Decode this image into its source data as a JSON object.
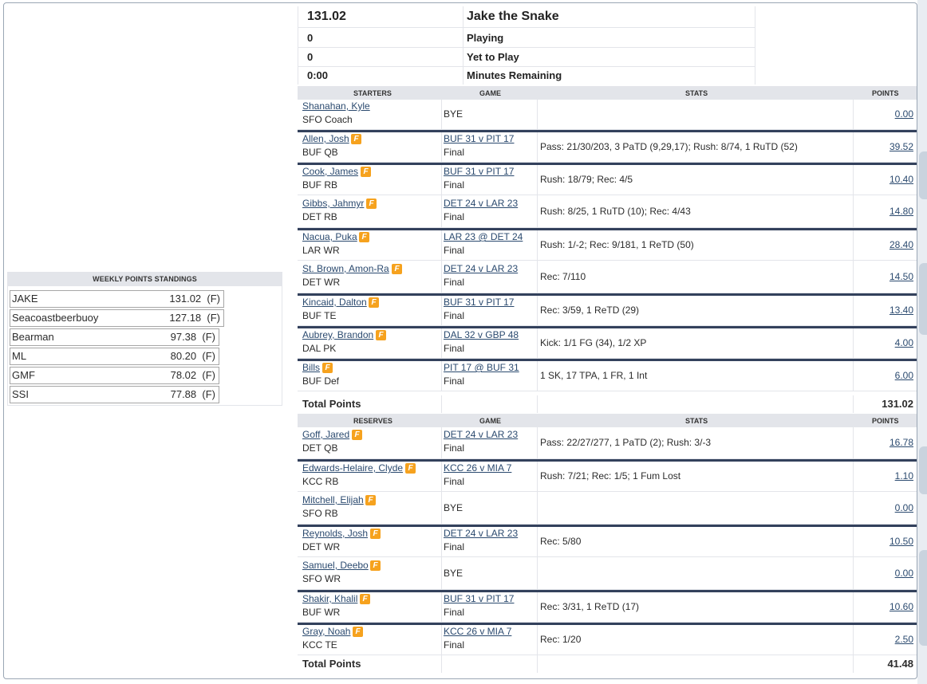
{
  "standings": {
    "title": "WEEKLY POINTS STANDINGS",
    "rows": [
      {
        "name": "JAKE",
        "points": "131.02",
        "flag": "(F)"
      },
      {
        "name": "Seacoastbeerbuoy",
        "points": "127.18",
        "flag": "(F)"
      },
      {
        "name": "Bearman",
        "points": "97.38",
        "flag": "(F)"
      },
      {
        "name": "ML",
        "points": "80.20",
        "flag": "(F)"
      },
      {
        "name": "GMF",
        "points": "78.02",
        "flag": "(F)"
      },
      {
        "name": "SSI",
        "points": "77.88",
        "flag": "(F)"
      }
    ]
  },
  "header": {
    "score": "131.02",
    "team": "Jake the Snake",
    "playing": {
      "value": "0",
      "label": "Playing"
    },
    "yet": {
      "value": "0",
      "label": "Yet to Play"
    },
    "minutes": {
      "value": "0:00",
      "label": "Minutes Remaining"
    }
  },
  "starters": {
    "columns": {
      "a": "STARTERS",
      "b": "GAME",
      "c": "STATS",
      "d": "POINTS"
    },
    "rows": [
      {
        "name": "Shanahan, Kyle",
        "pos": "SFO Coach",
        "game": "",
        "status": "BYE",
        "stats": "",
        "points": "0.00",
        "icon": false
      },
      {
        "name": "Allen, Josh",
        "pos": "BUF QB",
        "game": "BUF 31 v PIT 17",
        "status": "Final",
        "stats": "Pass: 21/30/203, 3 PaTD (9,29,17); Rush: 8/74, 1 RuTD (52)",
        "points": "39.52",
        "icon": true
      },
      {
        "name": "Cook, James",
        "pos": "BUF RB",
        "game": "BUF 31 v PIT 17",
        "status": "Final",
        "stats": "Rush: 18/79; Rec: 4/5",
        "points": "10.40",
        "icon": true
      },
      {
        "name": "Gibbs, Jahmyr",
        "pos": "DET RB",
        "game": "DET 24 v LAR 23",
        "status": "Final",
        "stats": "Rush: 8/25, 1 RuTD (10); Rec: 4/43",
        "points": "14.80",
        "icon": true
      },
      {
        "name": "Nacua, Puka",
        "pos": "LAR WR",
        "game": "LAR 23 @ DET 24",
        "status": "Final",
        "stats": "Rush: 1/-2; Rec: 9/181, 1 ReTD (50)",
        "points": "28.40",
        "icon": true
      },
      {
        "name": "St. Brown, Amon-Ra",
        "pos": "DET WR",
        "game": "DET 24 v LAR 23",
        "status": "Final",
        "stats": "Rec: 7/110",
        "points": "14.50",
        "icon": true
      },
      {
        "name": "Kincaid, Dalton",
        "pos": "BUF TE",
        "game": "BUF 31 v PIT 17",
        "status": "Final",
        "stats": "Rec: 3/59, 1 ReTD (29)",
        "points": "13.40",
        "icon": true
      },
      {
        "name": "Aubrey, Brandon",
        "pos": "DAL PK",
        "game": "DAL 32 v GBP 48",
        "status": "Final",
        "stats": "Kick: 1/1 FG (34), 1/2 XP",
        "points": "4.00",
        "icon": true
      },
      {
        "name": "Bills",
        "pos": "BUF Def",
        "game": "PIT 17 @ BUF 31",
        "status": "Final",
        "stats": "1 SK, 17 TPA, 1 FR, 1 Int",
        "points": "6.00",
        "icon": true
      }
    ],
    "total_label": "Total Points",
    "total_value": "131.02"
  },
  "reserves": {
    "columns": {
      "a": "RESERVES",
      "b": "GAME",
      "c": "STATS",
      "d": "POINTS"
    },
    "rows": [
      {
        "name": "Goff, Jared",
        "pos": "DET QB",
        "game": "DET 24 v LAR 23",
        "status": "Final",
        "stats": "Pass: 22/27/277, 1 PaTD (2); Rush: 3/-3",
        "points": "16.78",
        "icon": true
      },
      {
        "name": "Edwards-Helaire, Clyde",
        "pos": "KCC RB",
        "game": "KCC 26 v MIA 7",
        "status": "Final",
        "stats": "Rush: 7/21; Rec: 1/5; 1 Fum Lost",
        "points": "1.10",
        "icon": true
      },
      {
        "name": "Mitchell, Elijah",
        "pos": "SFO RB",
        "game": "",
        "status": "BYE",
        "stats": "",
        "points": "0.00",
        "icon": true
      },
      {
        "name": "Reynolds, Josh",
        "pos": "DET WR",
        "game": "DET 24 v LAR 23",
        "status": "Final",
        "stats": "Rec: 5/80",
        "points": "10.50",
        "icon": true
      },
      {
        "name": "Samuel, Deebo",
        "pos": "SFO WR",
        "game": "",
        "status": "BYE",
        "stats": "",
        "points": "0.00",
        "icon": true
      },
      {
        "name": "Shakir, Khalil",
        "pos": "BUF WR",
        "game": "BUF 31 v PIT 17",
        "status": "Final",
        "stats": "Rec: 3/31, 1 ReTD (17)",
        "points": "10.60",
        "icon": true
      },
      {
        "name": "Gray, Noah",
        "pos": "KCC TE",
        "game": "KCC 26 v MIA 7",
        "status": "Final",
        "stats": "Rec: 1/20",
        "points": "2.50",
        "icon": true
      }
    ],
    "total_label": "Total Points",
    "total_value": "41.48"
  },
  "icons": {
    "player_news": "fantasy-news-icon"
  },
  "colors": {
    "accent": "#33415c",
    "header_bg": "#e3e5ea",
    "icon": "#f6a21e",
    "link": "#2b4a6f"
  }
}
